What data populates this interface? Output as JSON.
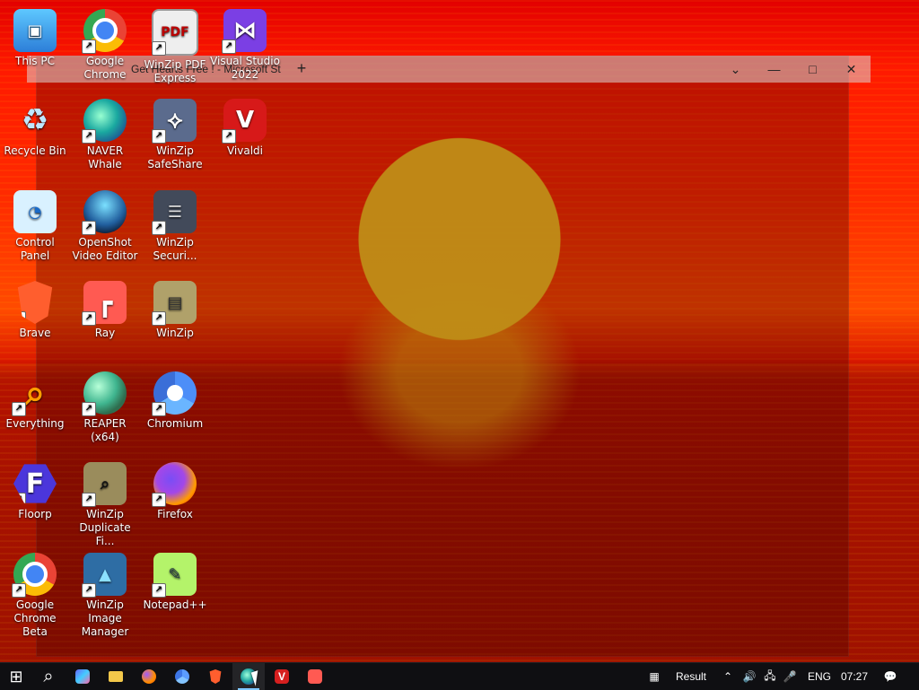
{
  "window": {
    "tab_title": "Get Hearts Free ! - Microsoft St",
    "new_tab": "+",
    "controls": {
      "dropdown": "⌄",
      "minimize": "—",
      "maximize": "□",
      "close": "✕"
    }
  },
  "desktop_icons": [
    {
      "label": "This PC",
      "icon": "computer-icon"
    },
    {
      "label": "Google Chrome",
      "icon": "chrome-icon"
    },
    {
      "label": "WinZip PDF Express",
      "icon": "pdf-icon"
    },
    {
      "label": "Visual Studio 2022",
      "icon": "visual-studio-icon"
    },
    {
      "label": "Recycle Bin",
      "icon": "recycle-bin-icon"
    },
    {
      "label": "NAVER Whale",
      "icon": "whale-icon"
    },
    {
      "label": "WinZip SafeShare",
      "icon": "share-icon"
    },
    {
      "label": "Vivaldi",
      "icon": "vivaldi-icon"
    },
    {
      "label": "Control Panel",
      "icon": "control-panel-icon"
    },
    {
      "label": "OpenShot Video Editor",
      "icon": "openshot-icon"
    },
    {
      "label": "WinZip Securi...",
      "icon": "security-icon"
    },
    {
      "label": "Brave",
      "icon": "brave-icon"
    },
    {
      "label": "Ray",
      "icon": "ray-icon"
    },
    {
      "label": "WinZip",
      "icon": "winzip-icon"
    },
    {
      "label": "Everything",
      "icon": "search-icon"
    },
    {
      "label": "REAPER (x64)",
      "icon": "reaper-icon"
    },
    {
      "label": "Chromium",
      "icon": "chromium-icon"
    },
    {
      "label": "Floorp",
      "icon": "floorp-icon"
    },
    {
      "label": "WinZip Duplicate Fi...",
      "icon": "duplicate-finder-icon"
    },
    {
      "label": "Firefox",
      "icon": "firefox-icon"
    },
    {
      "label": "Google Chrome Beta",
      "icon": "chrome-beta-icon"
    },
    {
      "label": "WinZip Image Manager",
      "icon": "image-manager-icon"
    },
    {
      "label": "Notepad++",
      "icon": "notepad-plus-plus-icon"
    }
  ],
  "taskbar": {
    "start": "⊞",
    "search": "⌕",
    "result": "Result",
    "lang": "ENG",
    "time": "07:27"
  },
  "colors": {
    "background_red": "#ff1a00",
    "sun_yellow": "#ffd223",
    "taskbar": "#0f0f12",
    "active_accent": "#7fc7ff"
  }
}
